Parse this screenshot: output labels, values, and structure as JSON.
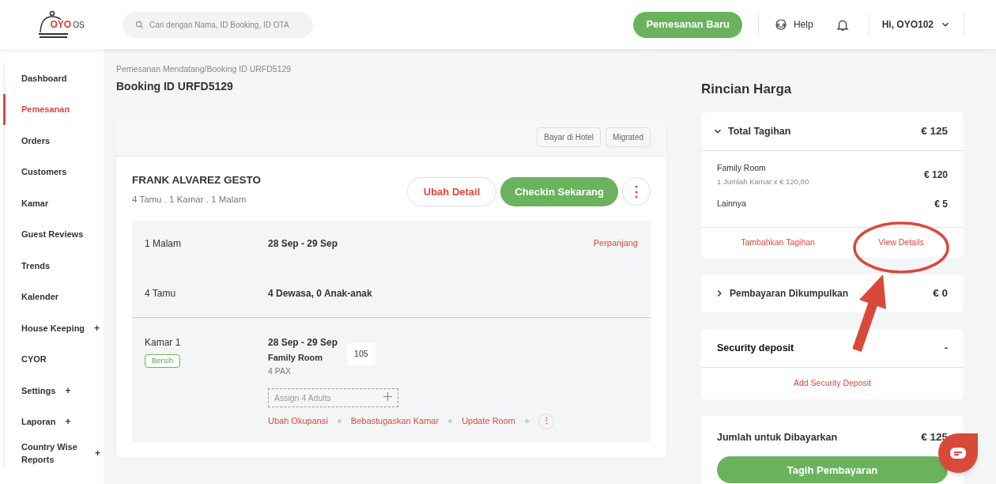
{
  "header": {
    "logo": {
      "brand": "OYO",
      "suffix": "OS"
    },
    "search": {
      "placeholder": "Cari dengan Nama, ID Booking, ID OTA"
    },
    "new_booking_button": "Pemesanan Baru",
    "help": "Help",
    "user": "Hi, OYO102"
  },
  "sidebar": {
    "items": [
      {
        "label": "Dashboard",
        "selected": false
      },
      {
        "label": "Pemesanan",
        "selected": true
      },
      {
        "label": "Orders",
        "selected": false
      },
      {
        "label": "Customers",
        "selected": false
      },
      {
        "label": "Kamar",
        "selected": false
      },
      {
        "label": "Guest Reviews",
        "selected": false
      },
      {
        "label": "Trends",
        "selected": false
      },
      {
        "label": "Kalender",
        "selected": false
      },
      {
        "label": "House Keeping",
        "selected": false,
        "toggle": "+"
      },
      {
        "label": "CYOR",
        "selected": false
      },
      {
        "label": "Settings",
        "selected": false,
        "toggle": "+"
      },
      {
        "label": "Laporan",
        "selected": false,
        "toggle": "+"
      },
      {
        "label": "Country Wise Reports",
        "selected": false,
        "toggle": "+"
      }
    ]
  },
  "breadcrumb": "Pemesanan Mendatang/Booking ID URFD5129",
  "page_title": "Booking ID URFD5129",
  "booking": {
    "tags": [
      "Bayar di Hotel",
      "Migrated"
    ],
    "guest_name": "FRANK ALVAREZ GESTO",
    "summary": "4 Tamu . 1 Kamar . 1 Malam",
    "edit_button": "Ubah Detail",
    "checkin_button": "Checkin Sekarang",
    "more": "⋮",
    "stay": {
      "label": "1 Malam",
      "value": "28 Sep - 29 Sep",
      "action": "Perpanjang"
    },
    "guests": {
      "label": "4 Tamu",
      "value": "4 Dewasa, 0 Anak-anak"
    },
    "room": {
      "label": "Kamar 1",
      "status": "Bersih",
      "dates": "28 Sep - 29 Sep",
      "type": "Family Room",
      "pax": "4 PAX",
      "number": "105",
      "assign_placeholder": "Assign 4 Adults",
      "actions": [
        "Ubah Okupansi",
        "Bebastugaskan Kamar",
        "Update Room"
      ],
      "more": "⋮"
    }
  },
  "price": {
    "title": "Rincian Harga",
    "total": {
      "label": "Total Tagihan",
      "amount": "€ 125",
      "expanded": true,
      "lines": [
        {
          "name": "Family Room",
          "detail": "1 Jumlah Kamar x € 120,00",
          "amount": "€ 120"
        },
        {
          "name": "Lainnya",
          "amount": "€ 5"
        }
      ],
      "links": [
        "Tambahkan Tagihan",
        "View Details"
      ]
    },
    "collected": {
      "label": "Pembayaran Dikumpulkan",
      "amount": "€ 0",
      "expanded": false
    },
    "deposit": {
      "label": "Security deposit",
      "amount": "-",
      "link": "Add Security Deposit"
    },
    "due": {
      "label": "Jumlah untuk Dibayarkan",
      "amount": "€ 125",
      "button": "Tagih Pembayaran"
    }
  }
}
